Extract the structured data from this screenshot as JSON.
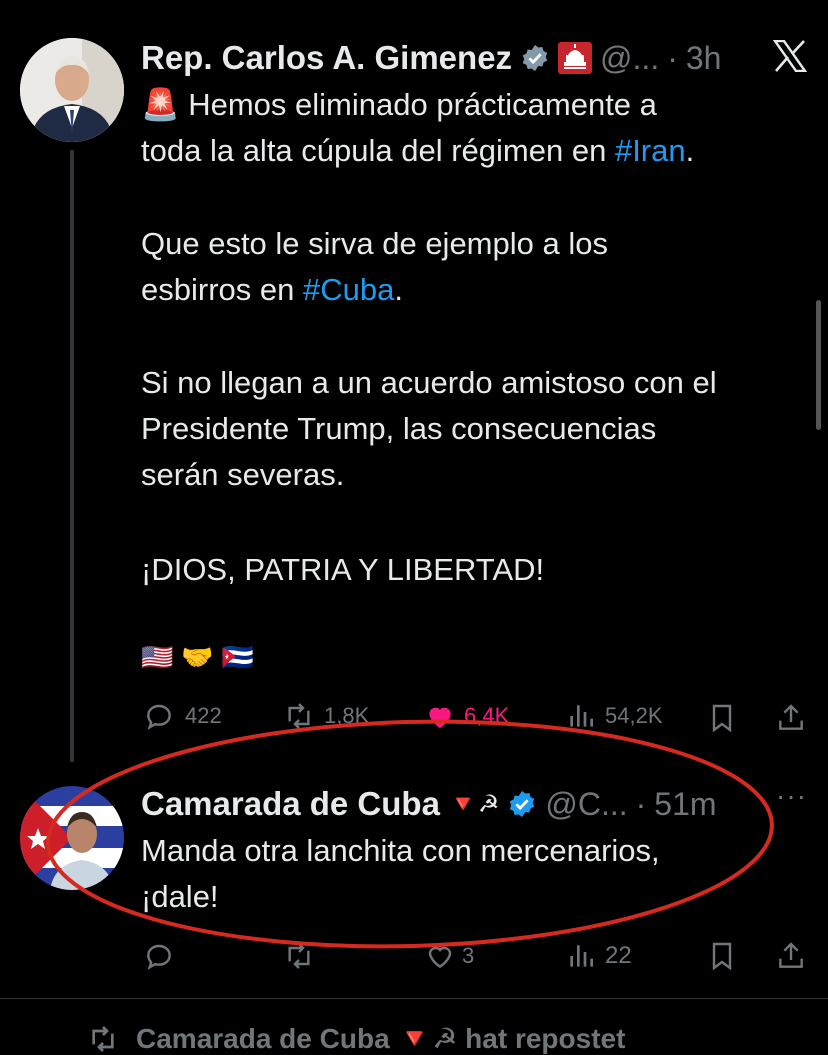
{
  "tweet1": {
    "author": "Rep. Carlos A. Gimenez",
    "handle": "@...",
    "dot": "·",
    "time": "3h",
    "siren_emoji": "🚨",
    "lines": [
      "Hemos eliminado prácticamente a",
      "toda la alta cúpula del régimen en",
      "#Iran",
      ".",
      "Que esto le sirva de ejemplo a los",
      "esbirros en",
      "#Cuba",
      ".",
      "Si no llegan a un acuerdo amistoso con el",
      "Presidente Trump, las consecuencias",
      "serán severas.",
      "¡DIOS, PATRIA Y LIBERTAD!"
    ],
    "emojis": [
      "🇺🇸",
      "🤝",
      "🇨🇺"
    ],
    "stats": {
      "replies": "422",
      "reposts": "1,8K",
      "likes": "6,4K",
      "views": "54,2K"
    }
  },
  "tweet2": {
    "author": "Camarada de Cuba",
    "author_emojis": "🔻☭",
    "handle": "@C...",
    "dot": "·",
    "time": "51m",
    "more": "···",
    "text_line1": "Manda otra lanchita con mercenarios,",
    "text_line2": "¡dale!",
    "stats": {
      "likes": "3",
      "views": "22"
    }
  },
  "footer": {
    "repost_text": "Camarada de Cuba 🔻☭ hat repostet"
  },
  "colors": {
    "accent": "#1d9bf0",
    "like": "#f91880",
    "annotation": "#d62a20",
    "background": "#000000"
  }
}
